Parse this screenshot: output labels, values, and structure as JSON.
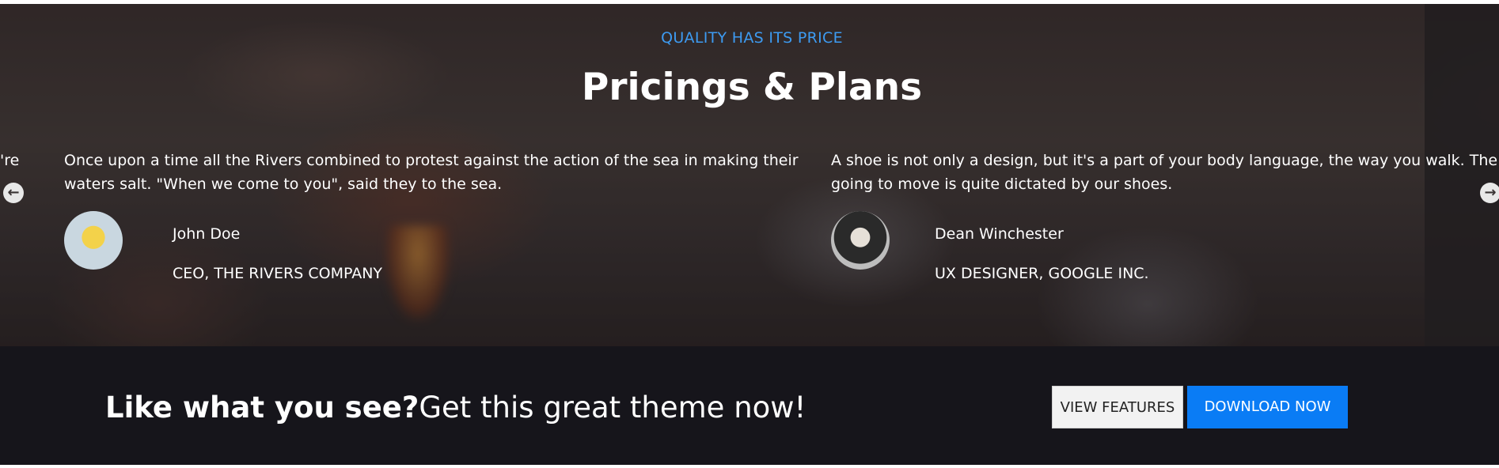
{
  "hero": {
    "eyebrow": "QUALITY HAS ITS PRICE",
    "title": "Pricings & Plans"
  },
  "testimonials": [
    {
      "quote_line1": "'re",
      "quote_line2": ""
    },
    {
      "quote_line1": "Once upon a time all the Rivers combined to protest against the action of the sea in making their",
      "quote_line2": "waters salt. \"When we come to you\", said they to the sea.",
      "name": "John Doe",
      "role": "CEO, THE RIVERS COMPANY"
    },
    {
      "quote_line1": "A shoe is not only a design, but it's a part of your body language, the way you walk. The way you",
      "quote_line2": "going to move is quite dictated by our shoes.",
      "name": "Dean Winchester",
      "role": "UX DESIGNER, GOOGLE INC."
    }
  ],
  "carousel": {
    "prev_icon": "←",
    "next_icon": "→"
  },
  "cta": {
    "bold": "Like what you see?",
    "light": "Get this great theme now!",
    "view_features": "VIEW FEATURES",
    "download": "DOWNLOAD NOW"
  },
  "colors": {
    "accent": "#3d9bf2",
    "primary_button": "#0a7cf5",
    "cta_background": "#16151b"
  }
}
